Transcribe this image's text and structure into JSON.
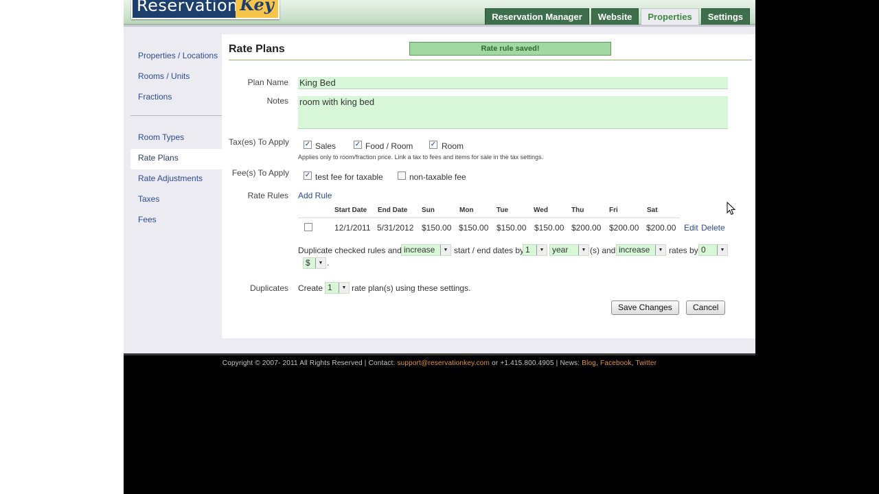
{
  "logo": {
    "word1": "Reservation",
    "word2": "Key"
  },
  "nav": {
    "tabs": [
      {
        "label": "Reservation Manager"
      },
      {
        "label": "Website"
      },
      {
        "label": "Properties",
        "active": true
      },
      {
        "label": "Settings"
      }
    ]
  },
  "sidebar": {
    "group1": [
      "Properties / Locations",
      "Rooms / Units",
      "Fractions"
    ],
    "group2": [
      "Room Types",
      "Rate Plans",
      "Rate Adjustments",
      "Taxes",
      "Fees"
    ],
    "active": "Rate Plans"
  },
  "content": {
    "title": "Rate Plans",
    "saved_message": "Rate rule saved!"
  },
  "form": {
    "plan_name_label": "Plan Name",
    "plan_name_value": "King Bed",
    "notes_label": "Notes",
    "notes_value": "room with king bed",
    "taxes_label": "Tax(es) To Apply",
    "taxes": [
      {
        "label": "Sales",
        "checked": true
      },
      {
        "label": "Food / Room",
        "checked": true
      },
      {
        "label": "Room",
        "checked": true
      }
    ],
    "taxes_hint": "Applies only to room/fraction price. Link a tax to fees and items for sale in the tax settings.",
    "fees_label": "Fee(s) To Apply",
    "fees": [
      {
        "label": "test fee for taxable",
        "checked": true
      },
      {
        "label": "non-taxable fee",
        "checked": false
      }
    ],
    "rate_rules_label": "Rate Rules",
    "add_rule": "Add Rule",
    "columns": [
      "Start Date",
      "End Date",
      "Sun",
      "Mon",
      "Tue",
      "Wed",
      "Thu",
      "Fri",
      "Sat"
    ],
    "rules": [
      {
        "checked": false,
        "cells": [
          "12/1/2011",
          "5/31/2012",
          "$150.00",
          "$150.00",
          "$150.00",
          "$150.00",
          "$200.00",
          "$200.00",
          "$200.00"
        ],
        "edit": "Edit",
        "delete": "Delete"
      }
    ],
    "duplicate": {
      "text1": "Duplicate checked rules and",
      "select1": "increase",
      "text2": "start / end dates by",
      "select2": "1",
      "select3": "year",
      "text3": "(s) and",
      "select4": "increase",
      "text4": "rates by",
      "select5": "0",
      "select6": "$",
      "text5": "."
    },
    "duplicates_label": "Duplicates",
    "create_text": "Create",
    "create_select": "1",
    "create_suffix": "rate plan(s) using these settings.",
    "save_button": "Save Changes",
    "cancel_button": "Cancel"
  },
  "footer": {
    "copyright": "Copyright © 2007- 2011 All Rights Reserved | Contact:",
    "email": "support@reservationkey.com",
    "phone": "or +1.415.800.4905 | News:",
    "blog": "Blog",
    "facebook": "Facebook",
    "twitter": "Twitter",
    "sep1": ",",
    "sep2": ","
  },
  "icons": {
    "check": "check-icon",
    "dropdown": "chevron-down-icon",
    "cursor": "mouse-pointer-icon"
  },
  "colors": {
    "accent_green": "#3e6e4c",
    "link_blue": "#2c4a8e",
    "input_green": "#d8f7d8"
  }
}
